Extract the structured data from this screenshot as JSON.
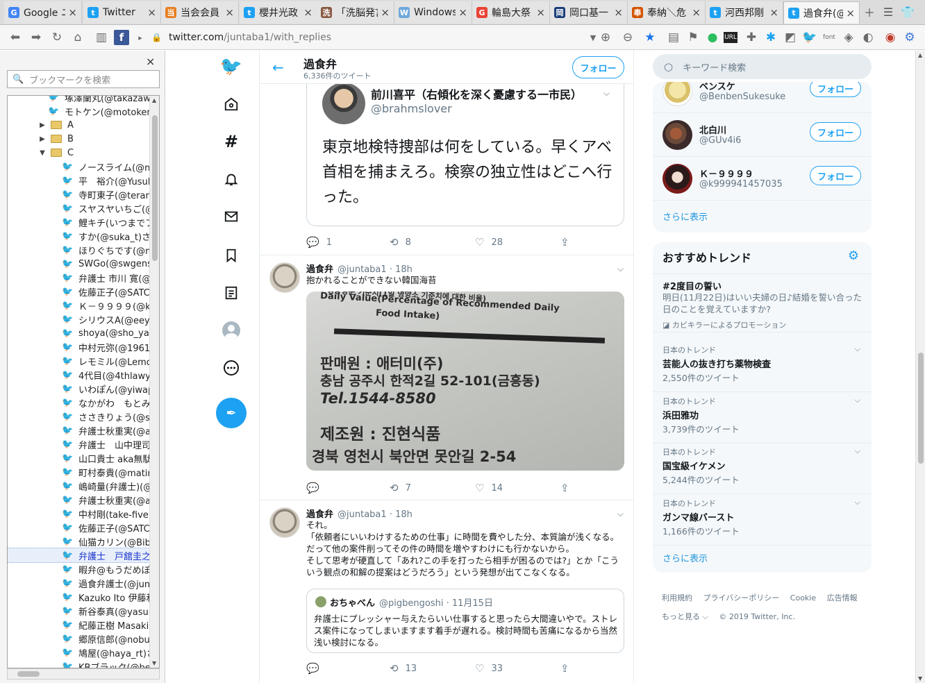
{
  "browser": {
    "tabs": [
      {
        "title": "Google ニ",
        "icon": "google-docs-icon",
        "color": "#4285f4",
        "glyph": "G"
      },
      {
        "title": "Twitter",
        "icon": "twitter-icon",
        "color": "#1da1f2",
        "glyph": "t"
      },
      {
        "title": "当会会員",
        "icon": "site-icon",
        "color": "#e67e22",
        "glyph": "当"
      },
      {
        "title": "櫻井光政",
        "icon": "twitter-icon",
        "color": "#1da1f2",
        "glyph": "t"
      },
      {
        "title": "「洗脳発言",
        "icon": "site-icon",
        "color": "#8a5a44",
        "glyph": "洗"
      },
      {
        "title": "Windows",
        "icon": "windows-icon",
        "color": "#6fa8dc",
        "glyph": "W"
      },
      {
        "title": "輪島大祭",
        "icon": "google-icon",
        "color": "#ea4335",
        "glyph": "G"
      },
      {
        "title": "岡口基一",
        "icon": "site-icon",
        "color": "#1c3f7a",
        "glyph": "岡"
      },
      {
        "title": "奉納＼危",
        "icon": "site-icon",
        "color": "#d35400",
        "glyph": "奉"
      },
      {
        "title": "河西邦剛",
        "icon": "twitter-icon",
        "color": "#1da1f2",
        "glyph": "t"
      },
      {
        "title": "過食弁(@",
        "icon": "twitter-icon",
        "color": "#1da1f2",
        "glyph": "t"
      }
    ],
    "url_host": "twitter.com",
    "url_path": "/juntaba1/with_replies"
  },
  "bookmarks": {
    "search_placeholder": "ブックマークを検索",
    "rows": [
      {
        "kind": "item",
        "label": "塚澤蘭丸(@takazawa"
      },
      {
        "kind": "item",
        "label": "モトケン(@motoken_"
      },
      {
        "kind": "folder",
        "label": "A",
        "open": false
      },
      {
        "kind": "folder",
        "label": "B",
        "open": false
      },
      {
        "kind": "folder",
        "label": "C",
        "open": true
      },
      {
        "kind": "child",
        "label": "ノースライム(@no"
      },
      {
        "kind": "child",
        "label": "平　裕介(@Yusul"
      },
      {
        "kind": "child",
        "label": "寺町東子(@teram"
      },
      {
        "kind": "child",
        "label": "スヤスヤいちご(@"
      },
      {
        "kind": "child",
        "label": "鯉キチ(いつまでフ"
      },
      {
        "kind": "child",
        "label": "すか(@suka_t)さ"
      },
      {
        "kind": "child",
        "label": "ほりぐちです(@ms"
      },
      {
        "kind": "child",
        "label": "SWGo(@swgens"
      },
      {
        "kind": "child",
        "label": "弁護士 市川 寛(@"
      },
      {
        "kind": "child",
        "label": "佐藤正子(@SATC"
      },
      {
        "kind": "child",
        "label": "Ｋ－９９９９(@k9"
      },
      {
        "kind": "child",
        "label": "シリウスA(@eeyy"
      },
      {
        "kind": "child",
        "label": "shoya(@sho_ya)"
      },
      {
        "kind": "child",
        "label": "中村元弥(@1961"
      },
      {
        "kind": "child",
        "label": "レモミル(@Lemor"
      },
      {
        "kind": "child",
        "label": "4代目(@4thlawy"
      },
      {
        "kind": "child",
        "label": "いわぽん(@yiwap"
      },
      {
        "kind": "child",
        "label": "なかがわ　もとみ"
      },
      {
        "kind": "child",
        "label": "ささきりょう(@ssk_"
      },
      {
        "kind": "child",
        "label": "弁護士秋重実(@a"
      },
      {
        "kind": "child",
        "label": "弁護士　山中理司"
      },
      {
        "kind": "child",
        "label": "山口貴士 aka無駄"
      },
      {
        "kind": "child",
        "label": "町村泰貴(@matin"
      },
      {
        "kind": "child",
        "label": "嶋崎量(弁護士)(@"
      },
      {
        "kind": "child",
        "label": "弁護士秋重実(@a"
      },
      {
        "kind": "child",
        "label": "中村剛(take-five"
      },
      {
        "kind": "child",
        "label": "佐藤正子(@SATC"
      },
      {
        "kind": "child",
        "label": "仙猫カリン(@Bibe"
      },
      {
        "kind": "child",
        "label": "弁護士　戸舘圭之",
        "selected": true
      },
      {
        "kind": "child",
        "label": "暇弁@もうだめぽ("
      },
      {
        "kind": "child",
        "label": "過食弁護士(@jun"
      },
      {
        "kind": "child",
        "label": "Kazuko Ito 伊藤和"
      },
      {
        "kind": "child",
        "label": "新谷泰真(@yasur"
      },
      {
        "kind": "child",
        "label": "紀藤正樹 Masaki"
      },
      {
        "kind": "child",
        "label": "郷原信郎(@nobu"
      },
      {
        "kind": "child",
        "label": "鳩屋(@haya_rt)さ"
      },
      {
        "kind": "child",
        "label": "KBブラック(@ben"
      }
    ]
  },
  "profile": {
    "name": "過食弁",
    "tweet_count": "6,336件のツイート",
    "follow_label": "フォロー"
  },
  "tweets": {
    "quoted_top": {
      "name": "前川喜平（右傾化を深く憂慮する一市民）",
      "handle": "@brahmslover",
      "text": "東京地検特捜部は何をしている。早くアベ首相を捕まえろ。検察の独立性はどこへ行った。",
      "reply_count": "1",
      "retweet_count": "8",
      "like_count": "28"
    },
    "t1": {
      "name": "過食弁",
      "handle": "@juntaba1",
      "time": "· 18h",
      "text": "抱かれることができない韓国海苔",
      "photo_lines": [
        "영양성분 기준치(1일 영양소 기준치에 대한 비율)",
        "Daily Value(Percentage of Recommended Daily",
        "Food Intake)",
        "판매원 : 애터미(주)",
        "충남 공주시 한적2길 52-101(금흥동)",
        "Tel.1544-8580",
        "제조원 : 진현식품",
        "경북 영천시 북안면 못안길 2-54"
      ],
      "retweet_count": "7",
      "like_count": "14"
    },
    "t2": {
      "name": "過食弁",
      "handle": "@juntaba1",
      "time": "· 18h",
      "text": "それ。\n「依頼者にいいわけするための仕事」に時間を費やした分、本質論が浅くなる。だって他の案件削ってその件の時間を増やすわけにも行かないから。\nそして思考が硬直して「あれ?この手を打ったら相手が困るのでは?」とか「こういう観点の和解の提案はどうだろう」という発想が出てこなくなる。",
      "quote_name": "おちゃべん",
      "quote_handle": "@pigbengoshi",
      "quote_date": "· 11月15日",
      "quote_text": "弁護士にプレッシャー与えたらいい仕事すると思ったら大間違いやで。ストレス案件になってしまいますます着手が遅れる。検討時間も苦痛になるから当然浅い検討になる。",
      "retweet_count": "13",
      "like_count": "33"
    }
  },
  "right": {
    "search_placeholder": "キーワード検索",
    "users": [
      {
        "name": "ベンスケ",
        "handle": "@BenbenSukesuke"
      },
      {
        "name": "北白川",
        "handle": "@GUv4i6"
      },
      {
        "name": "Ｋ－９９９９",
        "handle": "@k999941457035"
      }
    ],
    "follow_label": "フォロー",
    "show_more": "さらに表示",
    "trends_title": "おすすめトレンド",
    "promo": {
      "title": "#2度目の誓い",
      "desc": "明日(11月22日)はいい夫婦の日♪結婚を誓い合った日のことを覚えていますか?",
      "by": "カビキラーによるプロモーション"
    },
    "trends": [
      {
        "context": "日本のトレンド",
        "name": "芸能人の抜き打ち薬物検査",
        "count": "2,550件のツイート"
      },
      {
        "context": "日本のトレンド",
        "name": "浜田雅功",
        "count": "3,739件のツイート"
      },
      {
        "context": "日本のトレンド",
        "name": "国宝級イケメン",
        "count": "5,244件のツイート"
      },
      {
        "context": "日本のトレンド",
        "name": "ガンマ線バースト",
        "count": "1,166件のツイート"
      }
    ],
    "footer_links": [
      "利用規約",
      "プライバシーポリシー",
      "Cookie",
      "広告情報"
    ],
    "footer_more": "もっと見る ⌵",
    "copyright": "© 2019 Twitter, Inc."
  },
  "colors": {
    "twitter_blue": "#1da1f2",
    "link_blue": "#1b95e0",
    "muted": "#657786"
  }
}
